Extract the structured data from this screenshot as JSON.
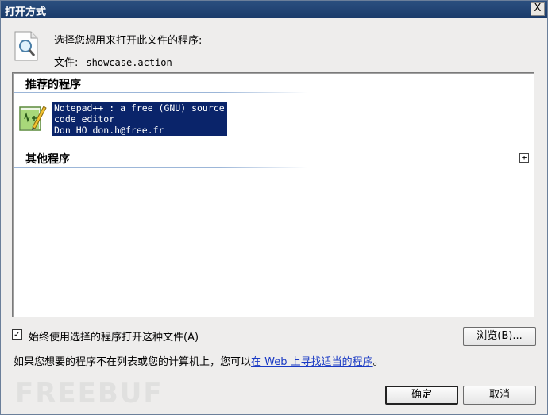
{
  "window": {
    "title": "打开方式",
    "close_glyph": "X"
  },
  "header": {
    "prompt": "选择您想用来打开此文件的程序:",
    "file_label": "文件:",
    "file_name": "showcase.action"
  },
  "list": {
    "recommended_header": "推荐的程序",
    "programs": [
      {
        "line1": "Notepad++ : a free (GNU) source",
        "line2": "code editor",
        "line3": "Don HO don.h@free.fr",
        "icon": "notepadplusplus-icon",
        "selected": true
      }
    ],
    "other_header": "其他程序",
    "expand_glyph": "+"
  },
  "options": {
    "always_use_label": "始终使用选择的程序打开这种文件(A)",
    "always_use_checked": true,
    "check_glyph": "✓",
    "browse_label": "浏览(B)..."
  },
  "info": {
    "text_before": "如果您想要的程序不在列表或您的计算机上，您可以",
    "link_text": "在 Web 上寻找适当的程序",
    "text_after": "。"
  },
  "buttons": {
    "ok_label": "确定",
    "cancel_label": "取消"
  },
  "watermark": {
    "text": "FREEBUF"
  },
  "colors": {
    "titlebar": "#1a3b6a",
    "selection": "#0a246a",
    "link": "#1a3ac4"
  }
}
